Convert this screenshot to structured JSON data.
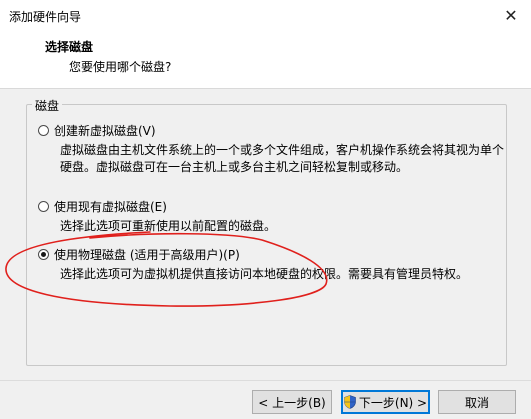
{
  "window": {
    "title": "添加硬件向导",
    "close_glyph": "✕"
  },
  "header": {
    "title": "选择磁盘",
    "subtitle": "您要使用哪个磁盘?"
  },
  "disk_group": {
    "label": "磁盘",
    "options": [
      {
        "label": "创建新虚拟磁盘(V)",
        "selected": false,
        "description": [
          "虚拟磁盘由主机文件系统上的一个或多个文件组成，客户机操作系统会将其视为单个",
          "硬盘。虚拟磁盘可在一台主机上或多台主机之间轻松复制或移动。"
        ]
      },
      {
        "label": "使用现有虚拟磁盘(E)",
        "selected": false,
        "description": [
          "选择此选项可重新使用以前配置的磁盘。"
        ]
      },
      {
        "label": "使用物理磁盘 (适用于高级用户)(P)",
        "selected": true,
        "description": [
          "选择此选项可为虚拟机提供直接访问本地硬盘的权限。需要具有管理员特权。"
        ]
      }
    ]
  },
  "buttons": {
    "back": "< 上一步(B)",
    "next": "下一步(N) >",
    "cancel": "取消"
  },
  "colors": {
    "annotation": "#e0201c",
    "default_button_border": "#0078d7"
  },
  "icons": {
    "close": "close-icon",
    "shield": "uac-shield-icon"
  }
}
